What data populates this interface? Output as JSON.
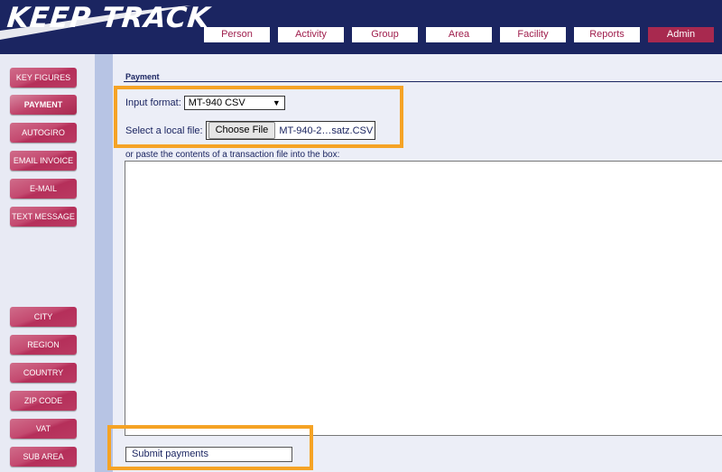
{
  "app": {
    "logo": "KEEP TRACK"
  },
  "nav": {
    "items": [
      {
        "label": "Person",
        "active": false
      },
      {
        "label": "Activity",
        "active": false
      },
      {
        "label": "Group",
        "active": false
      },
      {
        "label": "Area",
        "active": false
      },
      {
        "label": "Facility",
        "active": false
      },
      {
        "label": "Reports",
        "active": false
      },
      {
        "label": "Admin",
        "active": true
      }
    ]
  },
  "sidebar": {
    "items": [
      {
        "label": "KEY FIGURES",
        "active": false
      },
      {
        "label": "PAYMENT",
        "active": true
      },
      {
        "label": "AUTOGIRO",
        "active": false
      },
      {
        "label": "EMAIL INVOICE",
        "active": false
      },
      {
        "label": "E-MAIL",
        "active": false
      },
      {
        "label": "TEXT MESSAGE",
        "active": false
      },
      {
        "label": "CITY",
        "active": false
      },
      {
        "label": "REGION",
        "active": false
      },
      {
        "label": "COUNTRY",
        "active": false
      },
      {
        "label": "ZIP CODE",
        "active": false
      },
      {
        "label": "VAT",
        "active": false
      },
      {
        "label": "SUB AREA",
        "active": false
      }
    ]
  },
  "payment": {
    "title": "Payment",
    "input_format_label": "Input format:",
    "input_format_value": "MT-940 CSV",
    "local_file_label": "Select a local file:",
    "choose_file_label": "Choose File",
    "file_name": "MT-940-2…satz.CSV",
    "paste_label": "or paste the contents of a transaction file into the box:",
    "paste_value": "",
    "submit_label": "Submit payments"
  },
  "colors": {
    "header_bg": "#1b2561",
    "accent": "#a8294f",
    "highlight": "#f5a325",
    "rail": "#b7c4e4"
  }
}
